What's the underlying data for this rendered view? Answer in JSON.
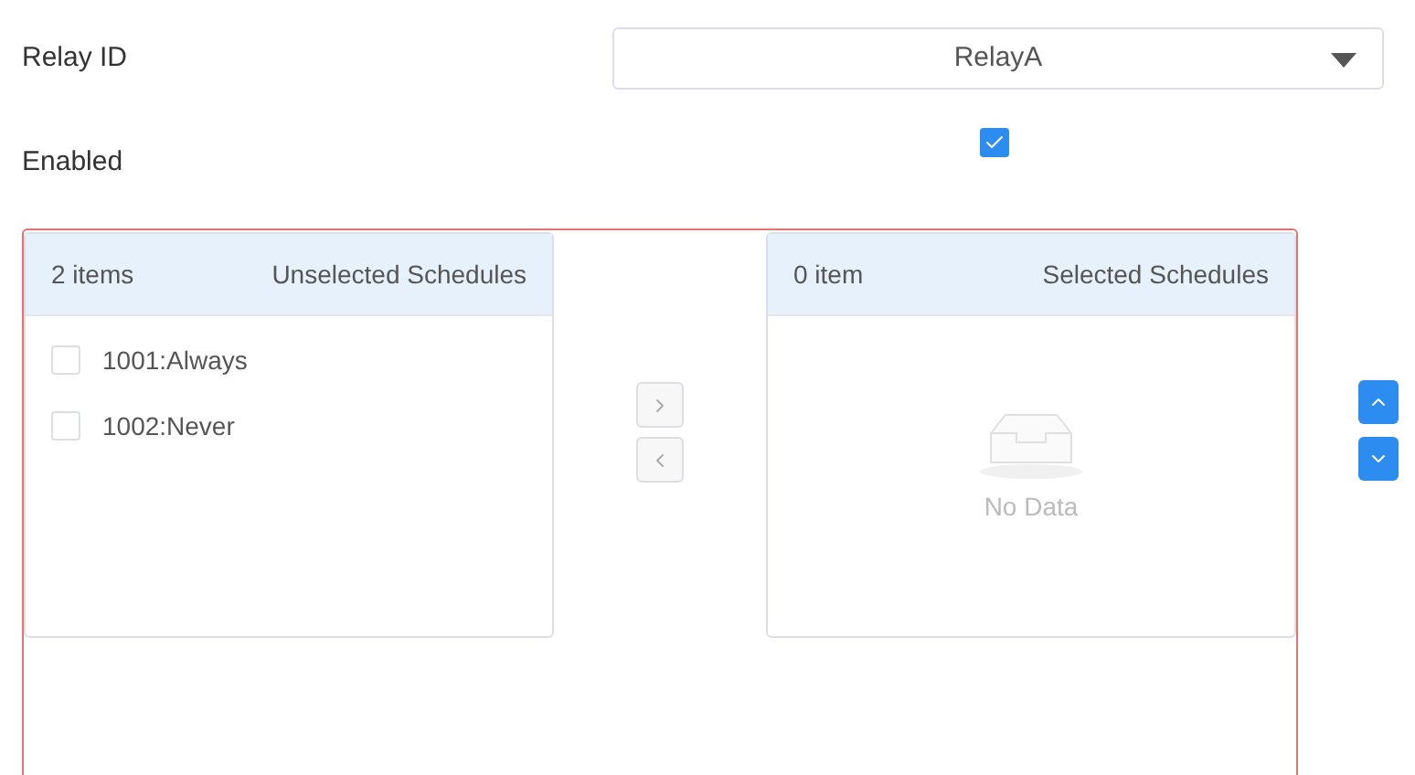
{
  "relay_id": {
    "label": "Relay ID",
    "value": "RelayA"
  },
  "enabled": {
    "label": "Enabled",
    "checked": true
  },
  "transfer": {
    "source": {
      "count": "2 items",
      "title": "Unselected Schedules",
      "items": [
        {
          "label": "1001:Always",
          "checked": false
        },
        {
          "label": "1002:Never",
          "checked": false
        }
      ]
    },
    "move_buttons": [
      {
        "kind": "right",
        "disabled": true
      },
      {
        "kind": "left",
        "disabled": true
      }
    ],
    "target": {
      "count": "0 item",
      "title": "Selected Schedules",
      "empty_text": "No Data"
    },
    "order_buttons": [
      {
        "kind": "up",
        "disabled": false
      },
      {
        "kind": "down",
        "disabled": false
      }
    ]
  }
}
